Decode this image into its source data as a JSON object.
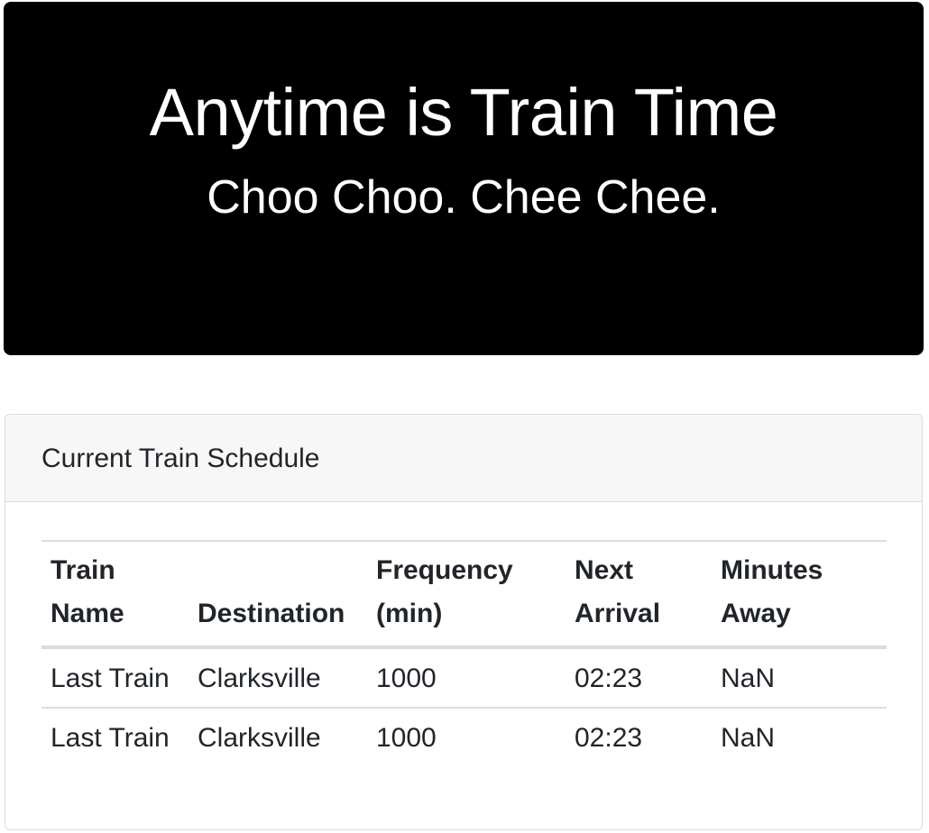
{
  "header": {
    "title": "Anytime is Train Time",
    "subtitle": "Choo Choo. Chee Chee."
  },
  "schedule": {
    "heading": "Current Train Schedule",
    "columns": [
      {
        "line1": "Train",
        "line2": "Name"
      },
      {
        "line1": "",
        "line2": "Destination"
      },
      {
        "line1": "Frequency",
        "line2": "(min)"
      },
      {
        "line1": "Next",
        "line2": "Arrival"
      },
      {
        "line1": "Minutes",
        "line2": "Away"
      }
    ],
    "rows": [
      [
        "Last Train",
        "Clarksville",
        "1000",
        "02:23",
        "NaN"
      ],
      [
        "Last Train",
        "Clarksville",
        "1000",
        "02:23",
        "NaN"
      ]
    ]
  }
}
